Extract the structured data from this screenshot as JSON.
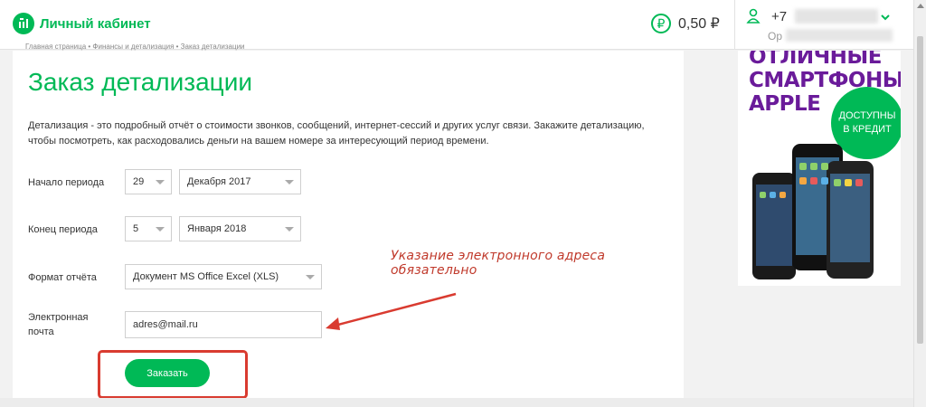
{
  "header": {
    "logo_text": "Личный кабинет",
    "balance": "0,50 ₽",
    "ruble_symbol": "₽",
    "phone_prefix": "+7",
    "org_prefix": "Ор"
  },
  "breadcrumb": "Главная страница  •  Финансы и детализация  •  Заказ детализации",
  "page": {
    "title": "Заказ детализации",
    "description": "Детализация - это подробный отчёт о стоимости звонков, сообщений, интернет-сессий и других услуг связи. Закажите детализацию, чтобы посмотреть, как расходовались деньги на вашем номере за интересующий период времени."
  },
  "form": {
    "start_label": "Начало периода",
    "start_day": "29",
    "start_month": "Декабря 2017",
    "end_label": "Конец периода",
    "end_day": "5",
    "end_month": "Января 2018",
    "format_label": "Формат отчёта",
    "format_value": "Документ MS Office Excel (XLS)",
    "email_label": "Электронная почта",
    "email_value": "adres@mail.ru",
    "submit_label": "Заказать"
  },
  "annotation": "Указание электронного адреса обязательно",
  "ad": {
    "headline": "ОТЛИЧНЫЕ СМАРТФОНЫ APPLE",
    "badge_line1": "ДОСТУПНЫ",
    "badge_line2": "В КРЕДИТ"
  },
  "colors": {
    "brand_green": "#00b956",
    "annotation_red": "#d93b30",
    "ad_purple": "#6a1b9a"
  }
}
